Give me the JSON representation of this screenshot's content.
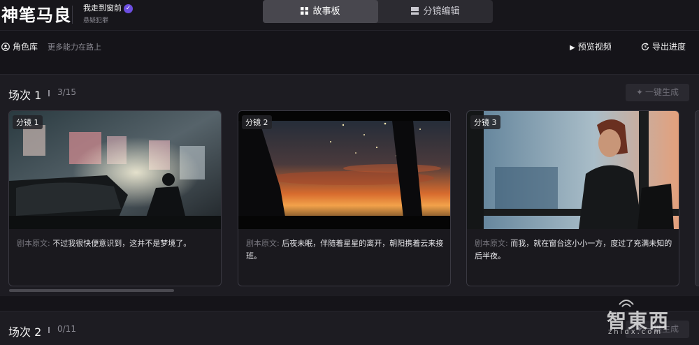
{
  "header": {
    "logo": "神笔马良",
    "project_title": "我走到窗前",
    "project_subtitle": "悬疑犯罪",
    "tabs": [
      {
        "label": "故事板",
        "active": true
      },
      {
        "label": "分镜编辑",
        "active": false
      }
    ]
  },
  "toolbar": {
    "character_library": "角色库",
    "hint": "更多能力在路上",
    "preview": "预览视频",
    "export": "导出进度"
  },
  "scenes": [
    {
      "title": "场次 1",
      "count": "3/15",
      "generate_label": "一键生成",
      "shots": [
        {
          "tag": "分镜 1",
          "label": "剧本原文:",
          "text": "不过我很快便意识到，这并不是梦境了。"
        },
        {
          "tag": "分镜 2",
          "label": "剧本原文:",
          "text": "后夜未眠，伴随着星星的离开，朝阳携着云来接班。"
        },
        {
          "tag": "分镜 3",
          "label": "剧本原文:",
          "text": "而我，就在窗台这小小一方，度过了充满未知的后半夜。"
        }
      ]
    },
    {
      "title": "场次 2",
      "count": "0/11",
      "generate_label": "一键生成"
    }
  ],
  "watermark": {
    "main": "智東西",
    "sub": "zhidx.com"
  },
  "colors": {
    "accent": "#6c4ee0",
    "background": "#151419",
    "panel": "#1d1c22"
  }
}
